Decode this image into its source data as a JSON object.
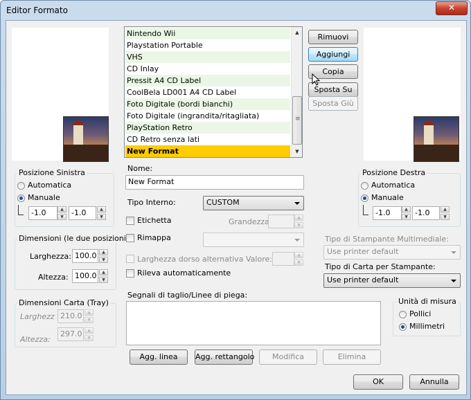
{
  "window": {
    "title": "Editor Formato",
    "close_glyph": "✕"
  },
  "format_list": {
    "items": [
      "Nintendo Wii",
      "Playstation Portable",
      "VHS",
      "CD Inlay",
      "Pressit A4 CD Label",
      "CoolBela LD001 A4 CD Label",
      "Foto Digitale (bordi bianchi)",
      "Foto Digitale (ingrandita/ritagliata)",
      "PlayStation Retro",
      "CD Retro senza lati",
      "New Format"
    ],
    "selected_index": 10
  },
  "actions": {
    "remove": "Rimuovi",
    "add": "Aggiungi",
    "copy": "Copia",
    "move_up": "Sposta Su",
    "move_down": "Sposta Giù"
  },
  "left_position": {
    "title": "Posizione Sinistra",
    "auto": "Automatica",
    "manual": "Manuale",
    "x": "-1.0",
    "y": "-1.0"
  },
  "right_position": {
    "title": "Posizione Destra",
    "auto": "Automatica",
    "manual": "Manuale",
    "x": "-1.0",
    "y": "-1.0"
  },
  "dimensions": {
    "title": "Dimensioni (le  due posizioni)",
    "width_label": "Larghezza:",
    "width": "100.0",
    "height_label": "Altezza:",
    "height": "100.0"
  },
  "paper_dimensions": {
    "title": "Dimensioni Carta (Tray)",
    "width_label": "Larghezz",
    "width": "210.0",
    "height_label": "Altezza:",
    "height": "297.0"
  },
  "name": {
    "label": "Nome:",
    "value": "New Format"
  },
  "internal_type": {
    "label": "Tipo Interno:",
    "value": "CUSTOM"
  },
  "label_opt": {
    "label": "Etichetta",
    "size_label": "Grandezza",
    "size_value": ""
  },
  "remap": {
    "label": "Rimappa",
    "value": ""
  },
  "alt_spine": {
    "label": "Larghezza dorso alternativa",
    "value_label": "Valore:",
    "value": ""
  },
  "auto_detect": {
    "label": "Rileva automaticamente"
  },
  "cut_lines": {
    "label": "Segnali di taglio/Linee di piega:",
    "value": ""
  },
  "line_buttons": {
    "add_line": "Agg. linea",
    "add_rect": "Agg. rettangolo",
    "edit": "Modifica",
    "delete": "Elimina"
  },
  "printer_media": {
    "label": "Tipo di Stampante Multimediale:",
    "value": "Use printer default"
  },
  "paper_type": {
    "label": "Tipo di Carta per Stampante:",
    "value": "Use printer default"
  },
  "units": {
    "title": "Unità di misura",
    "inches": "Pollici",
    "mm": "Millimetri"
  },
  "footer": {
    "ok": "OK",
    "cancel": "Annulla"
  }
}
